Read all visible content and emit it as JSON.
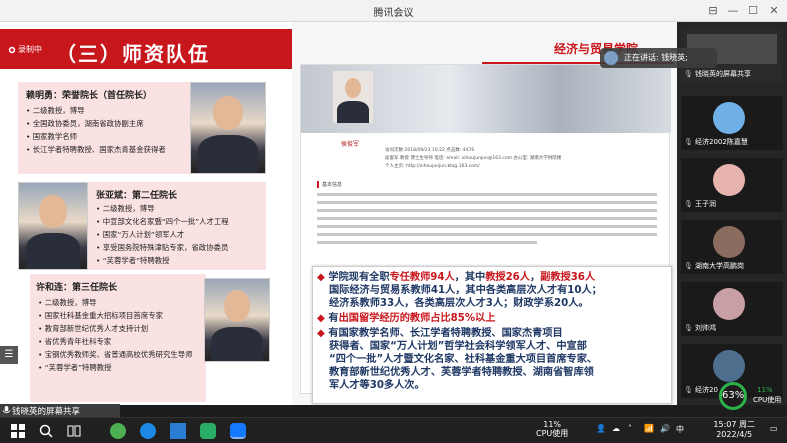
{
  "window": {
    "title": "腾讯会议",
    "pin_icon": "⊟",
    "min_icon": "—",
    "max_icon": "☐",
    "close_icon": "✕"
  },
  "slide": {
    "rec_label": "录制中",
    "section_title": "（三）师资队伍",
    "cards": [
      {
        "name": "赖明勇：荣誉院长（首任院长）",
        "items": [
          "二级教授，博导",
          "全国政协委员，湖南省政协副主席",
          "国家教学名师",
          "长江学者特聘教授、国家杰青基金获得者"
        ]
      },
      {
        "name": "张亚斌：第二任院长",
        "items": [
          "二级教授，博导",
          "中宣部文化名家暨“四个一批”人才工程",
          "国家“万人计划”领军人才",
          "享受国务院特殊津贴专家，省政协委员",
          "“芙蓉学者”特聘教授"
        ]
      },
      {
        "name": "许和连：第三任院长",
        "items": [
          "二级教授，博导",
          "国家社科基金重大招标项目首席专家",
          "教育部新世纪优秀人才支持计划",
          "省优秀青年社科专家",
          "宝钢优秀教师奖、省普通高校优秀研究生导师",
          "“芙蓉学者”特聘教授"
        ]
      }
    ],
    "ribbon_title": "经济与贸易学院",
    "doc": {
      "name": "侯俊军",
      "meta_line1": "访问次数:2018/09/23 10:22 点击数: 4476",
      "meta_line2": "侯俊军 教授 博士生导师 电话: email: xihoujunjun@163.com 办公室: 湖南大学财院楼",
      "meta_line3": "个人主页: http://xihoujunjun.blog.163.com/",
      "section": "基本信息"
    },
    "highlights": [
      {
        "parts": [
          {
            "t": "学院现有全职",
            "c": ""
          },
          {
            "t": "专任教师94人",
            "c": "red"
          },
          {
            "t": "，其中",
            "c": ""
          },
          {
            "t": "教授26人",
            "c": "red"
          },
          {
            "t": "，",
            "c": ""
          },
          {
            "t": "副教授36人",
            "c": "red"
          }
        ]
      },
      {
        "parts": [
          {
            "t": "国际经济与贸易系教师41人，其中各类高层次人才有10人；",
            "c": ""
          }
        ]
      },
      {
        "parts": [
          {
            "t": "经济系教师33人，各类高层次人才3人；财政学系20人。",
            "c": ""
          }
        ]
      },
      {
        "parts": [
          {
            "t": "有",
            "c": ""
          },
          {
            "t": "出国留学经历的教师占比85%以上",
            "c": "red"
          }
        ]
      },
      {
        "parts": [
          {
            "t": "有国家教学名师、长江学者特聘教授、国家杰青项目",
            "c": ""
          }
        ]
      },
      {
        "parts": [
          {
            "t": "获得者、国家“万人计划”哲学社会科学领军人才、中宣部",
            "c": ""
          }
        ]
      },
      {
        "parts": [
          {
            "t": "“四个一批”人才暨文化名家、社科基金重大项目首席专家、",
            "c": ""
          }
        ]
      },
      {
        "parts": [
          {
            "t": "教育部新世纪优秀人才、芙蓉学者特聘教授、湖南省智库领",
            "c": ""
          }
        ]
      },
      {
        "parts": [
          {
            "t": "军人才等30多人次。",
            "c": ""
          }
        ]
      }
    ]
  },
  "share_bar": {
    "label": "钱晓英的屏幕共享"
  },
  "speaking": {
    "label": "正在讲话: 钱晓英;"
  },
  "participants": [
    {
      "name": "钱晓英的屏幕共享",
      "avatar": "#7b9fc7"
    },
    {
      "name": "经济2002陈嘉慧",
      "avatar": "#6fb1e6"
    },
    {
      "name": "王子润",
      "avatar": "#e7b4ad"
    },
    {
      "name": "湖南大学高鹏岗",
      "avatar": "#8a6c5e"
    },
    {
      "name": "刘帅鸿",
      "avatar": "#c99fa6"
    },
    {
      "name": "经济20",
      "avatar": "#4e6e8e"
    }
  ],
  "cpu": {
    "badge": "63%",
    "pct": "11%",
    "label": "CPU使用"
  },
  "taskbar": {
    "cpu_pct": "11%",
    "cpu_label": "CPU使用",
    "ime": "中",
    "time": "15:07 周二",
    "date": "2022/4/5"
  }
}
